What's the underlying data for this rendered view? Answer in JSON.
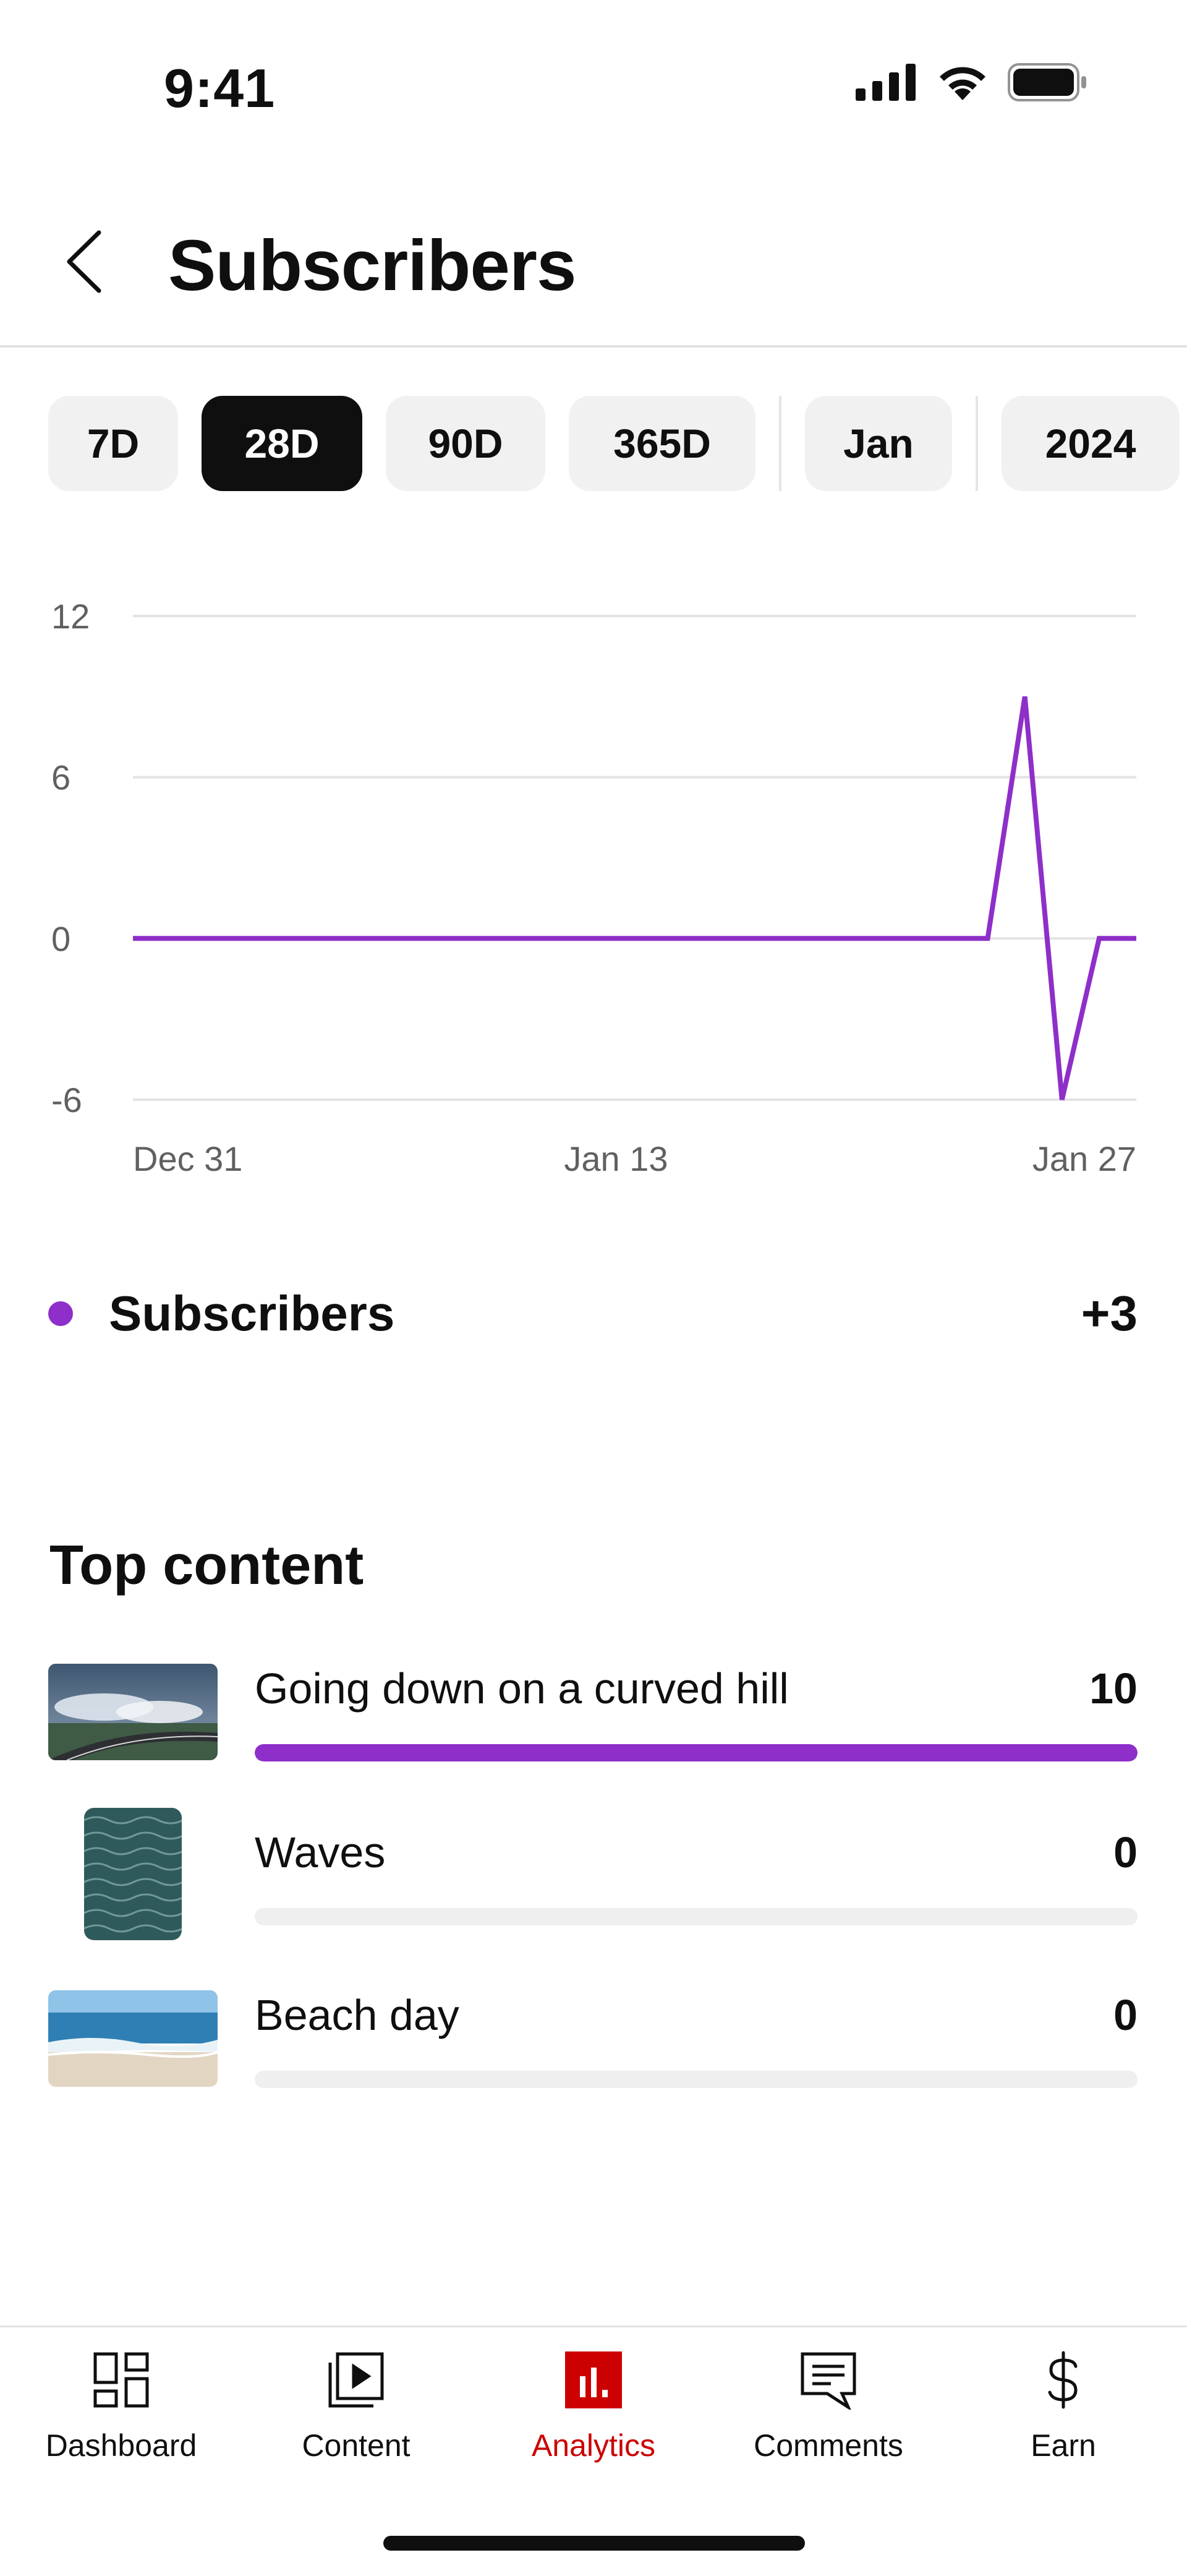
{
  "status": {
    "time": "9:41"
  },
  "header": {
    "title": "Subscribers"
  },
  "chips": [
    {
      "label": "7D",
      "active": false
    },
    {
      "label": "28D",
      "active": true
    },
    {
      "label": "90D",
      "active": false
    },
    {
      "label": "365D",
      "active": false
    },
    {
      "label": "Jan",
      "active": false
    },
    {
      "label": "2024",
      "active": false
    }
  ],
  "chart_data": {
    "type": "line",
    "ylim": [
      -6,
      12
    ],
    "yticks": [
      "12",
      "6",
      "0",
      "-6"
    ],
    "xticks": [
      "Dec 31",
      "Jan 13",
      "Jan 27"
    ],
    "grid": true,
    "series": [
      {
        "name": "Subscribers",
        "color": "#8e2fc9",
        "x": [
          "Dec 31",
          "Jan 1",
          "Jan 2",
          "Jan 3",
          "Jan 4",
          "Jan 5",
          "Jan 6",
          "Jan 7",
          "Jan 8",
          "Jan 9",
          "Jan 10",
          "Jan 11",
          "Jan 12",
          "Jan 13",
          "Jan 14",
          "Jan 15",
          "Jan 16",
          "Jan 17",
          "Jan 18",
          "Jan 19",
          "Jan 20",
          "Jan 21",
          "Jan 22",
          "Jan 23",
          "Jan 24",
          "Jan 25",
          "Jan 26",
          "Jan 27"
        ],
        "values": [
          0,
          0,
          0,
          0,
          0,
          0,
          0,
          0,
          0,
          0,
          0,
          0,
          0,
          0,
          0,
          0,
          0,
          0,
          0,
          0,
          0,
          0,
          0,
          0,
          9,
          -6,
          0,
          0
        ]
      }
    ]
  },
  "legend": {
    "label": "Subscribers",
    "value": "+3",
    "color": "#8e2fc9"
  },
  "top_content": {
    "title": "Top content",
    "items": [
      {
        "title": "Going down on a curved hill",
        "value": "10",
        "fraction": 1.0,
        "thumb": "road-hill"
      },
      {
        "title": "Waves",
        "value": "0",
        "fraction": 0,
        "thumb": "waves"
      },
      {
        "title": "Beach day",
        "value": "0",
        "fraction": 0,
        "thumb": "beach"
      }
    ]
  },
  "nav": {
    "items": [
      {
        "label": "Dashboard",
        "icon": "dashboard-icon",
        "active": false
      },
      {
        "label": "Content",
        "icon": "content-icon",
        "active": false
      },
      {
        "label": "Analytics",
        "icon": "analytics-icon",
        "active": true
      },
      {
        "label": "Comments",
        "icon": "comments-icon",
        "active": false
      },
      {
        "label": "Earn",
        "icon": "earn-icon",
        "active": false
      }
    ]
  },
  "colors": {
    "accent": "#8e2fc9",
    "active_nav": "#cc0000",
    "chip_active_bg": "#0f0f0f",
    "chip_bg": "#f1f1f1"
  }
}
